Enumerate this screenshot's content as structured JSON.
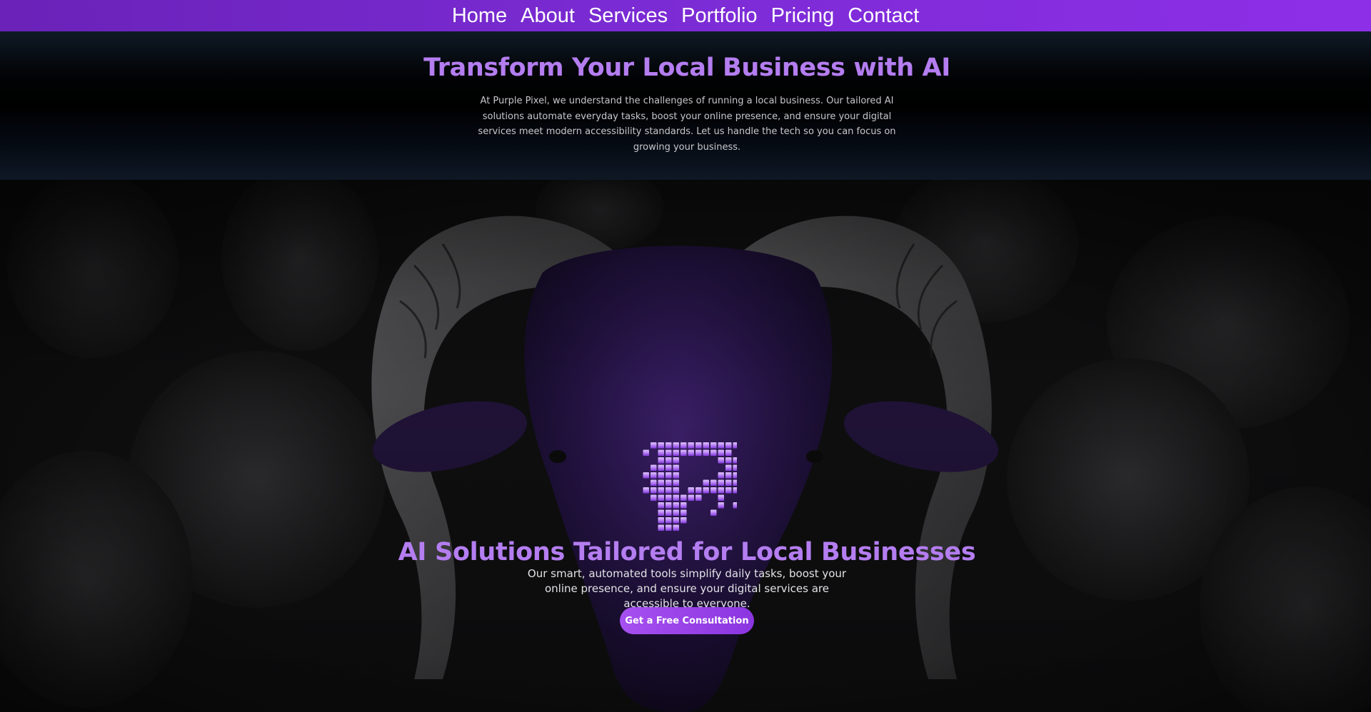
{
  "nav": {
    "items": [
      {
        "label": "Home"
      },
      {
        "label": "About"
      },
      {
        "label": "Services"
      },
      {
        "label": "Portfolio"
      },
      {
        "label": "Pricing"
      },
      {
        "label": "Contact"
      }
    ]
  },
  "intro": {
    "title": "Transform Your Local Business with AI",
    "body": "At Purple Pixel, we understand the challenges of running a local business. Our tailored AI solutions automate everyday tasks, boost your online presence, and ensure your digital services meet modern accessibility standards. Let us handle the tech so you can focus on growing your business."
  },
  "hero": {
    "title": "AI Solutions Tailored for Local Businesses",
    "subtitle": "Our smart, automated tools simplify daily tasks, boost your online presence, and ensure your digital services are accessible to everyone.",
    "cta_label": "Get a Free Consultation",
    "logo_icon": "pixel-p-logo-icon",
    "background_image": "purple-ram-among-sheep-image"
  },
  "colors": {
    "nav_start": "#6a22b8",
    "nav_end": "#8e2fe8",
    "heading_purple": "#b47df0",
    "cta_start": "#a650f0",
    "cta_end": "#8b35e0"
  }
}
